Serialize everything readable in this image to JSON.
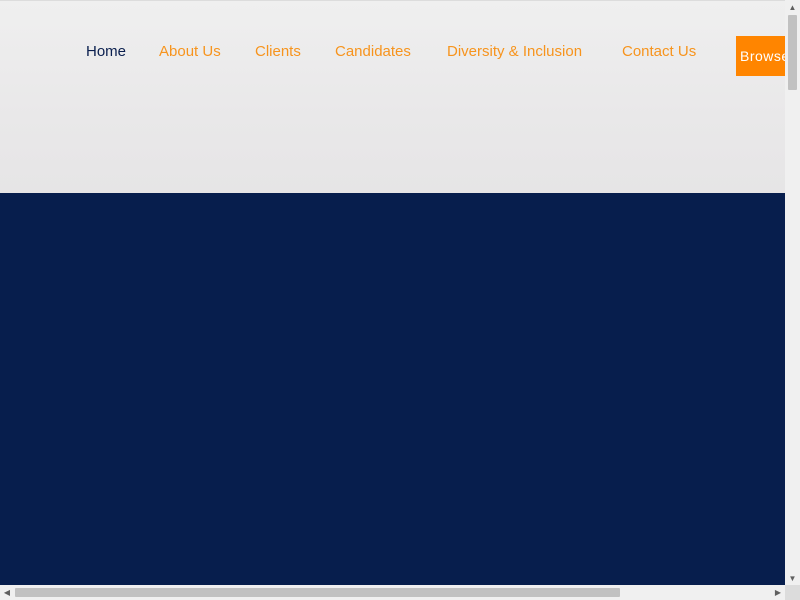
{
  "nav": {
    "items": [
      {
        "label": "Home",
        "active": true
      },
      {
        "label": "About Us"
      },
      {
        "label": "Clients"
      },
      {
        "label": "Candidates"
      },
      {
        "label": "Diversity & Inclusion"
      },
      {
        "label": "Contact Us"
      }
    ],
    "browse_label": "Browse"
  },
  "colors": {
    "accent_orange": "#f7941d",
    "button_orange": "#ff8500",
    "navy": "#071e4d",
    "active_nav": "#0a1f4e"
  },
  "scrollbars": {
    "up_icon": "triangle-up",
    "down_icon": "triangle-down",
    "left_icon": "triangle-left",
    "right_icon": "triangle-right"
  }
}
